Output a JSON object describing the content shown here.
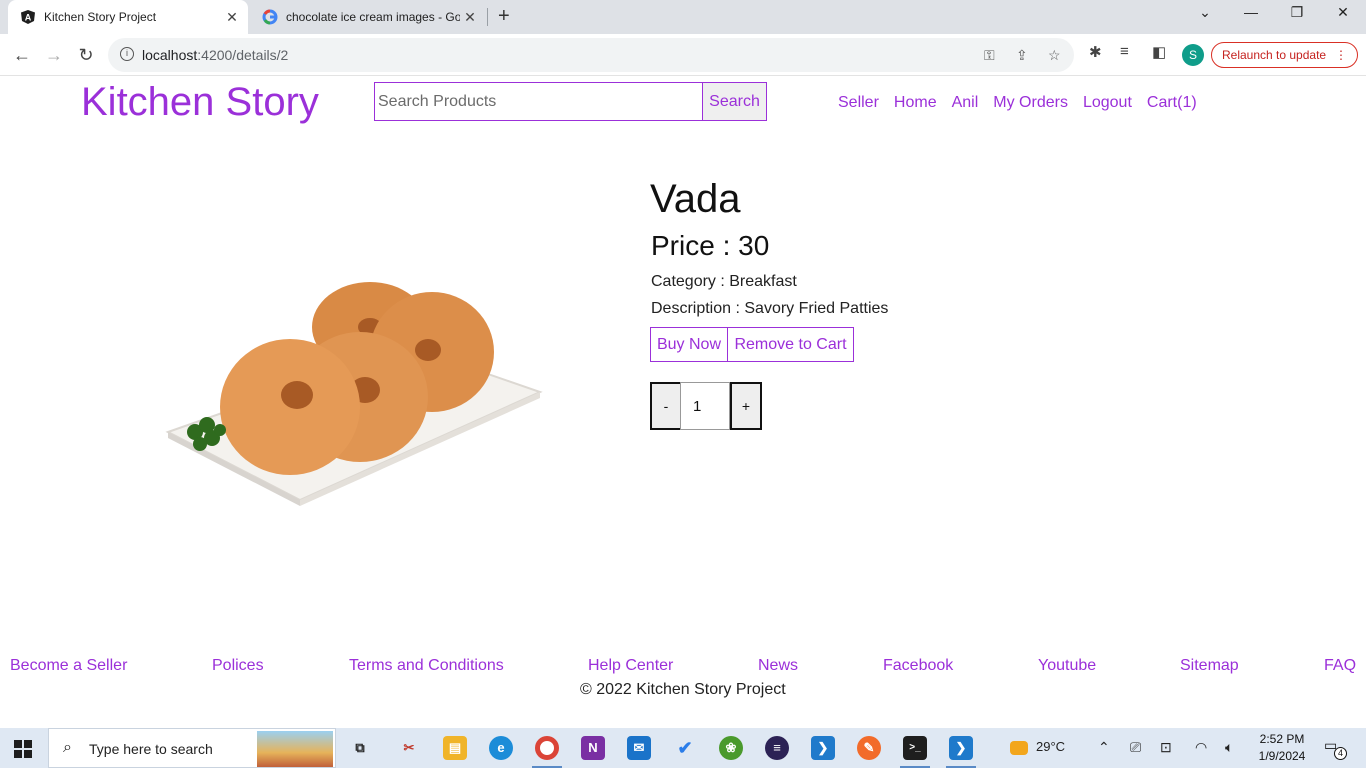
{
  "browser": {
    "tabs": [
      {
        "title": "Kitchen Story Project",
        "favicon": "angular-icon"
      },
      {
        "title": "chocolate ice cream images - Go",
        "favicon": "google-icon"
      }
    ],
    "url_host": "localhost",
    "url_path": ":4200/details/2",
    "relaunch_label": "Relaunch to update",
    "profile_initial": "S"
  },
  "header": {
    "brand": "Kitchen Story",
    "search_placeholder": "Search Products",
    "search_label": "Search",
    "nav": [
      "Seller",
      "Home",
      "Anil",
      "My Orders",
      "Logout",
      "Cart(1)"
    ]
  },
  "product": {
    "name": "Vada",
    "price_label": "Price : 30",
    "category_label": "Category : Breakfast",
    "description_label": "Description : Savory Fried Patties",
    "buy_label": "Buy Now",
    "remove_label": "Remove to Cart",
    "qty_minus": "-",
    "qty_value": "1",
    "qty_plus": "+"
  },
  "footer": {
    "links": [
      "Become a Seller",
      "Polices",
      "Terms and Conditions",
      "Help Center",
      "News",
      "Facebook",
      "Youtube",
      "Sitemap",
      "FAQ"
    ],
    "copyright": "© 2022 Kitchen Story Project"
  },
  "taskbar": {
    "search_placeholder": "Type here to search",
    "temperature": "29°C",
    "time": "2:52 PM",
    "date": "1/9/2024",
    "notification_count": "4"
  },
  "colors": {
    "accent": "#9b30d9",
    "taskbar": "#dfe8f3"
  }
}
